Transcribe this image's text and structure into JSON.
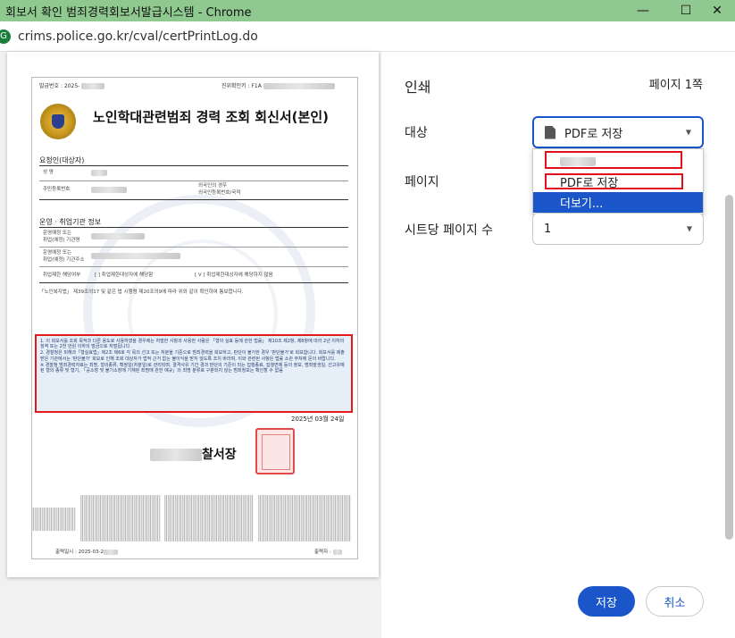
{
  "window": {
    "title": "회보서 확인 범죄경력회보서발급시스템 - Chrome",
    "minimize": "—",
    "maximize": "☐",
    "close": "✕"
  },
  "address": {
    "site_icon": "G",
    "url": "crims.police.go.kr/cval/certPrintLog.do"
  },
  "document": {
    "issue_no_label": "발급번호 : 2025-",
    "verify_label": "진위확인키 : F1A",
    "title": "노인학대관련범죄 경력 조회 회신서(본인)",
    "requester_section": "요청인(대상자)",
    "name_label": "성 명",
    "resident_no_label": "주민등록번호",
    "foreigner_label_1": "외국인의 경우",
    "foreigner_label_2": "외국인등록번호/국적",
    "operator_section": "운영 · 취업기관 정보",
    "org_name_label_1": "운영예정 또는",
    "org_name_label_2": "취업(예정) 기관명",
    "org_addr_label_1": "운영예정 또는",
    "org_addr_label_2": "취업(예정) 기관주소",
    "restriction_label": "취업제한 해당여부",
    "restriction_opt1": "[ ] 취업제한대상자에 해당함",
    "restriction_opt2": "[ V ] 취업제한대상자에 해당하지 않음",
    "law_line": "「노인복지법」 제39조의17 및 같은 법 시행령 제20조의9에 따라 위와 같이 확인하여 통보합니다.",
    "notices": [
      "1. 이 회보서를 조회 목적과 다른 용도로 사용하였을 경우에는 처벌한 사항과 사용한 사람은 「형의 실효 등에 관한 법률」 제10조 제2항, 제8항에 따라 2년 이하의 징역 또는 2천 만원 이하의 벌금으로 처벌됩니다.",
      "2. 경찰청은 피해과「형실효법」제2조 제6호 각 목의 선고 또는 처분을 기준으로 범죄경력을 회보하고, 판단이 불가한 경우 '판단불가'로 회보합니다. 회보서를 제출받은 기관에서는 '판단불가' 회보로 인해 조회 대상자가 법적 근거 없는 불이익을 받지 않도록 조치 바라며, 이와 관련된 사항은 법률 소관 부처에 문의 바랍니다.",
      "※ 경찰청 범죄경력자료는 죄명, 형의종류, 확정일(처분일)로 관리되며, 결격사유 기간 경과 판단의 기준이 되는 집행종료, 집행면제 등의 정보, 범죄발생일, 선고유예된 형의 종류 및 형기, 「공소장 및 불기소장에 기재된 죄명에 관한 예규」의 죄명 분류로 구분되지 않는 범죄정보는 확인할 수 없음"
    ],
    "date": "2025년   03월   24일",
    "issuer_suffix": "찰서장",
    "print_date": "출력일시 : 2025-03-2",
    "printer_label": "출력자 :"
  },
  "panel": {
    "title": "인쇄",
    "page_count": "페이지 1쪽",
    "dest_label": "대상",
    "dest_value": "PDF로 저장",
    "pages_label": "페이지",
    "sheet_label": "시트당 페이지 수",
    "sheet_value": "1",
    "dropdown": [
      "PDF로 저장",
      "더보기..."
    ],
    "caret": "▼",
    "save": "저장",
    "cancel": "취소"
  }
}
